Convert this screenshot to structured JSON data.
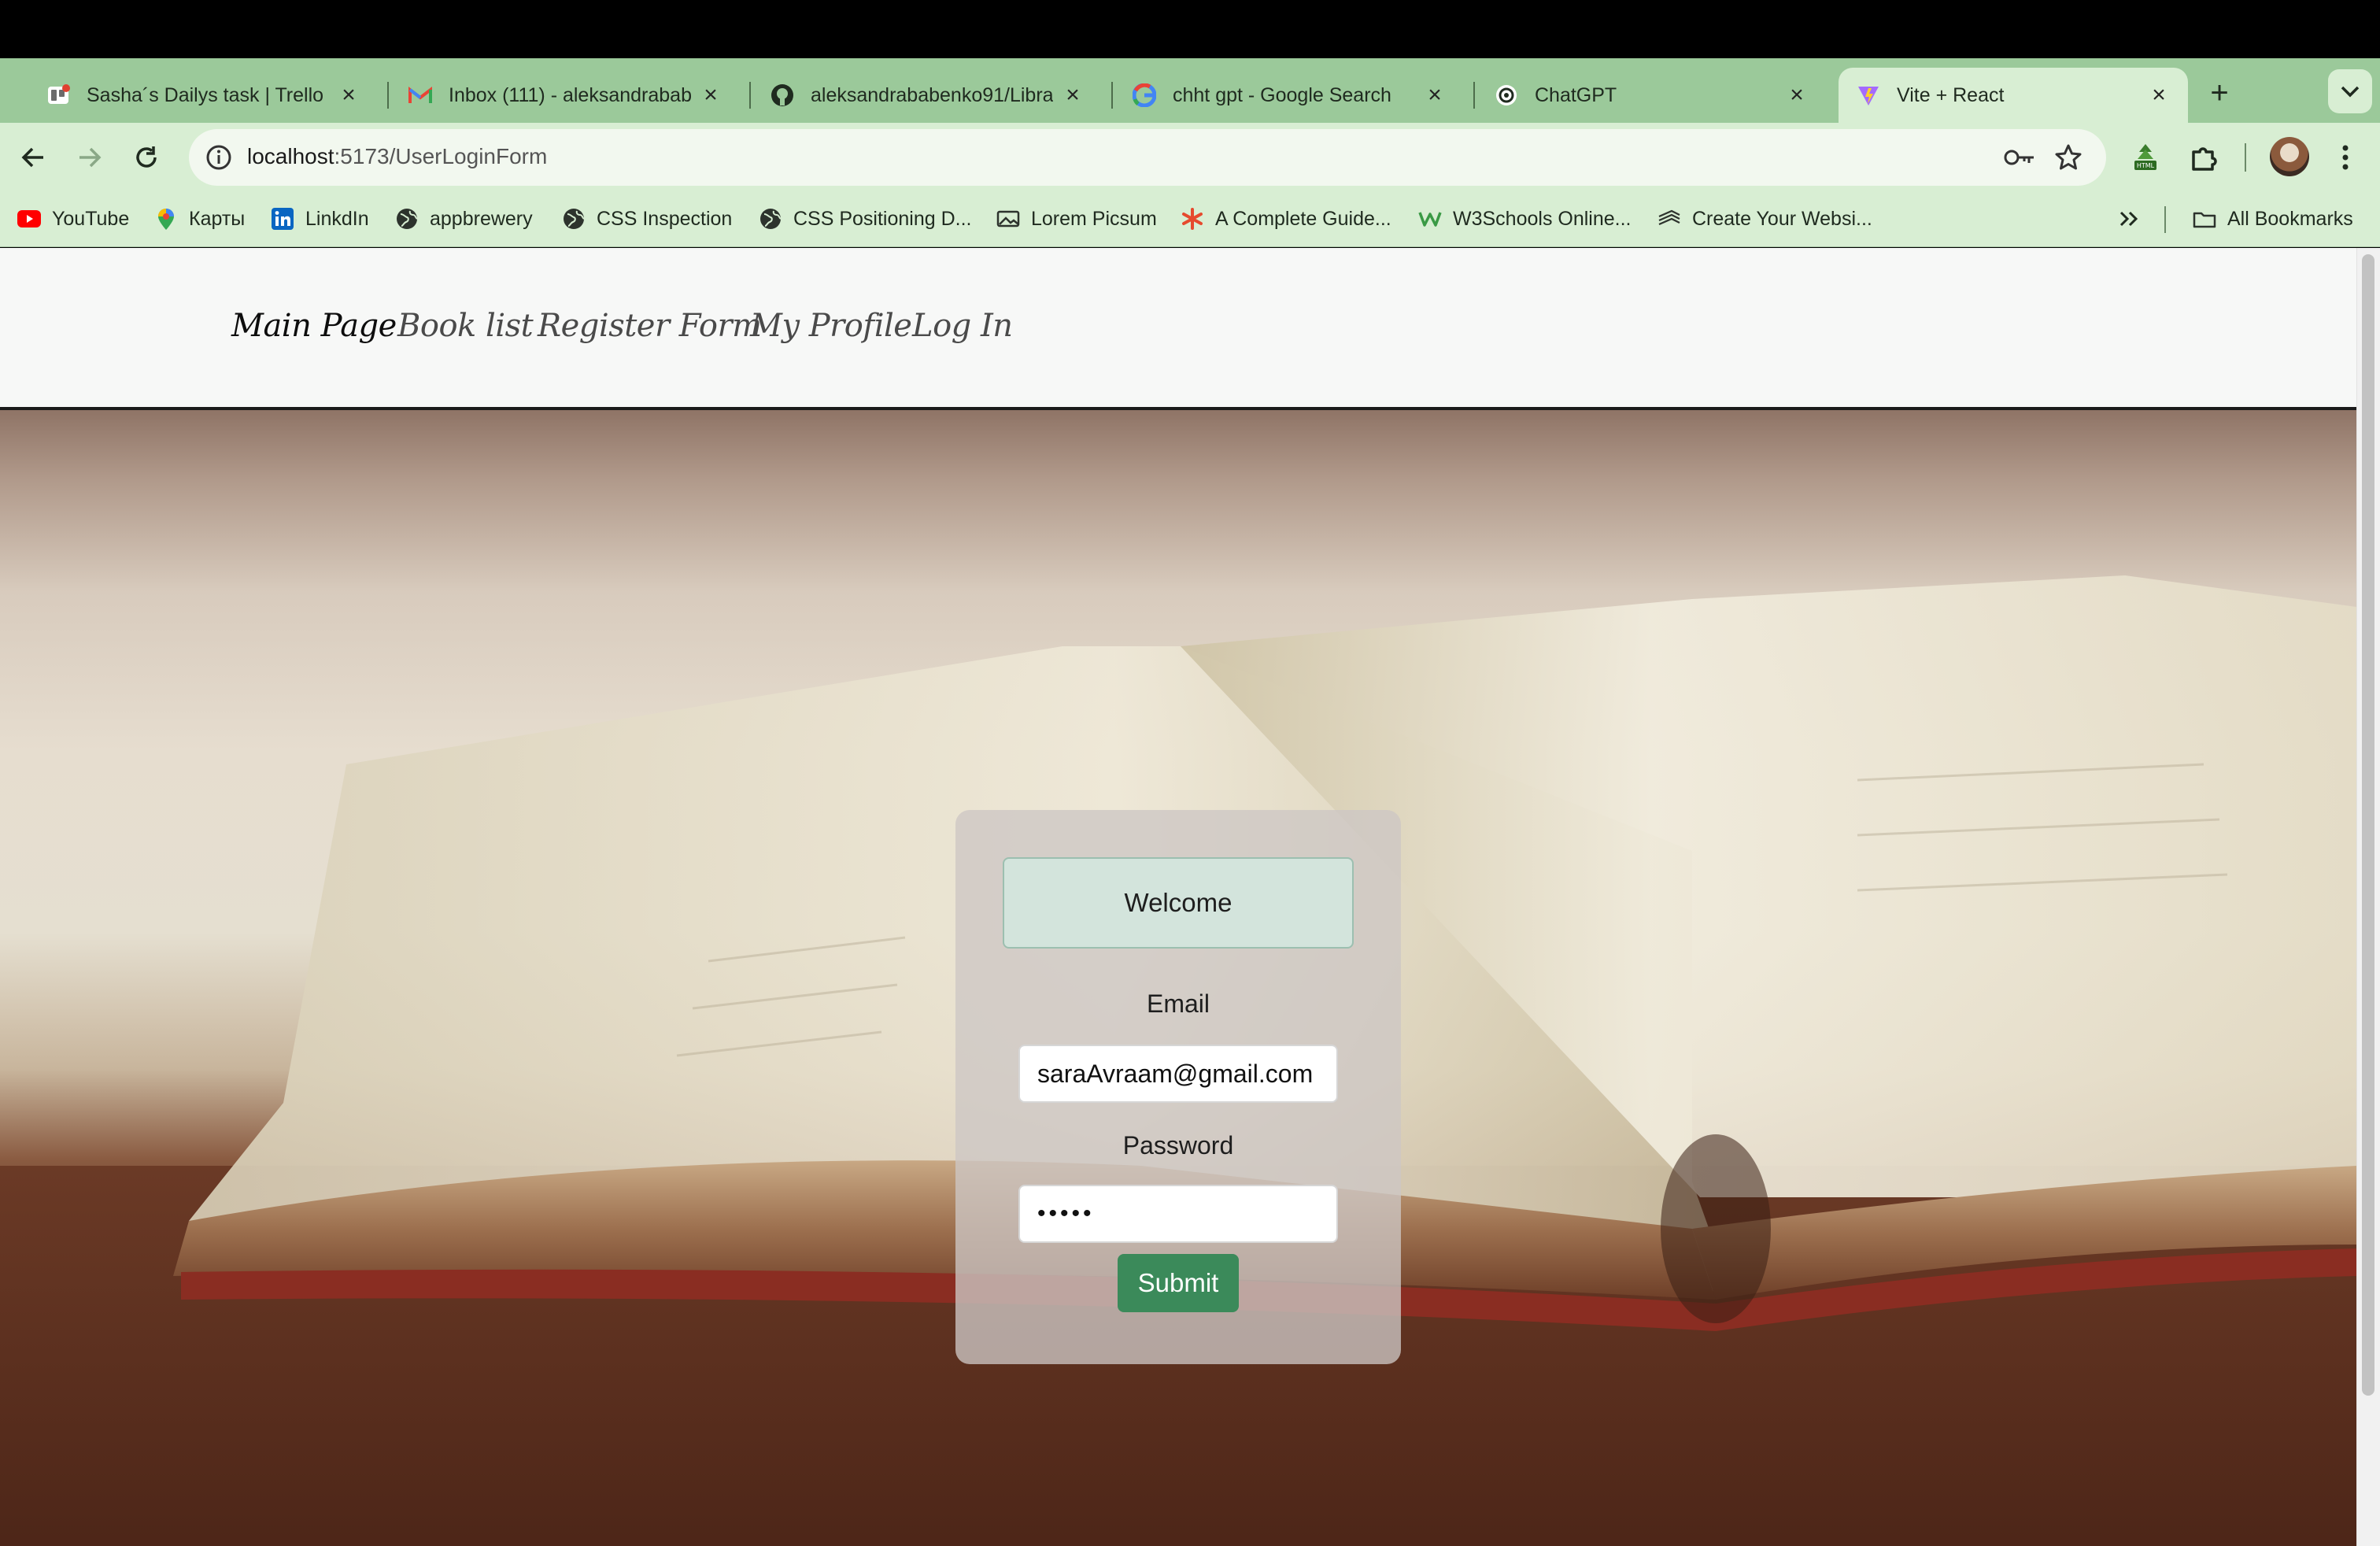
{
  "browser": {
    "tabs": [
      {
        "title": "Sasha´s Dailys task | Trello",
        "icon": "trello-icon"
      },
      {
        "title": "Inbox (111) - aleksandrababenko91",
        "icon": "gmail-icon"
      },
      {
        "title": "aleksandrababenko91/Library",
        "icon": "github-icon"
      },
      {
        "title": "chht gpt - Google Search",
        "icon": "google-icon"
      },
      {
        "title": "ChatGPT",
        "icon": "chatgpt-icon"
      },
      {
        "title": "Vite + React",
        "icon": "vite-icon",
        "active": true
      }
    ],
    "address": {
      "host": "localhost",
      "path": ":5173/UserLoginForm"
    },
    "bookmarks": [
      {
        "label": "YouTube",
        "icon": "youtube-icon"
      },
      {
        "label": "Карты",
        "icon": "maps-pin-icon"
      },
      {
        "label": "LinkdIn",
        "icon": "linkedin-icon"
      },
      {
        "label": "appbrewery",
        "icon": "globe-icon"
      },
      {
        "label": "CSS Inspection",
        "icon": "globe-icon"
      },
      {
        "label": "CSS Positioning D...",
        "icon": "globe-icon"
      },
      {
        "label": "Lorem Picsum",
        "icon": "image-icon"
      },
      {
        "label": "A Complete Guide...",
        "icon": "asterisk-icon"
      },
      {
        "label": "W3Schools Online...",
        "icon": "w3schools-icon"
      },
      {
        "label": "Create Your Websi...",
        "icon": "layers-icon"
      }
    ],
    "all_bookmarks_label": "All Bookmarks",
    "colors": {
      "tab_bar": "#9bc99a",
      "toolbar": "#d8eed3"
    }
  },
  "site": {
    "nav": [
      "Main Page",
      "Book list",
      "Register Form",
      "My Profile",
      "Log In"
    ],
    "current_nav": "Main Page"
  },
  "login": {
    "welcome": "Welcome",
    "email_label": "Email",
    "email_value": "saraAvraam@gmail.com",
    "password_label": "Password",
    "password_value": "•••••",
    "submit_label": "Submit",
    "colors": {
      "submit": "#3b8a5a",
      "welcome_bg": "#d3e4dc"
    }
  }
}
